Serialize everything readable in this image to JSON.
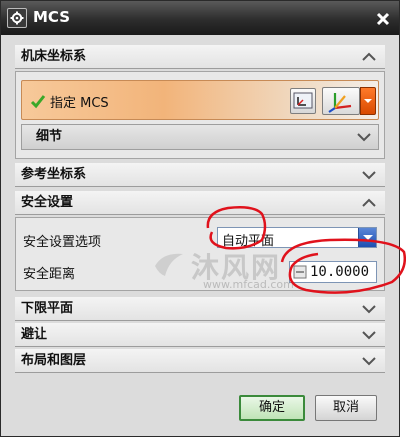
{
  "window": {
    "title": "MCS"
  },
  "sections": {
    "machine_cs": {
      "title": "机床坐标系",
      "expanded": true
    },
    "reference_cs": {
      "title": "参考坐标系",
      "expanded": false
    },
    "clearance": {
      "title": "安全设置",
      "expanded": true
    },
    "lower_limit": {
      "title": "下限平面",
      "expanded": false
    },
    "avoidance": {
      "title": "避让",
      "expanded": false
    },
    "layout_layers": {
      "title": "布局和图层",
      "expanded": false
    }
  },
  "machine_cs": {
    "specify_label": "指定 MCS",
    "details_label": "细节"
  },
  "clearance": {
    "option_label": "安全设置选项",
    "option_value": "自动平面",
    "distance_label": "安全距离",
    "distance_value": "10.0000"
  },
  "watermark": {
    "text": "沐风网",
    "url": "www.mfcad.com"
  },
  "buttons": {
    "ok": "确定",
    "cancel": "取消"
  },
  "colors": {
    "annotation": "#e0121c",
    "accent_orange": "#f2b47a",
    "ok_green": "#3b8a3b",
    "title_bar": "#2d2d2d"
  }
}
